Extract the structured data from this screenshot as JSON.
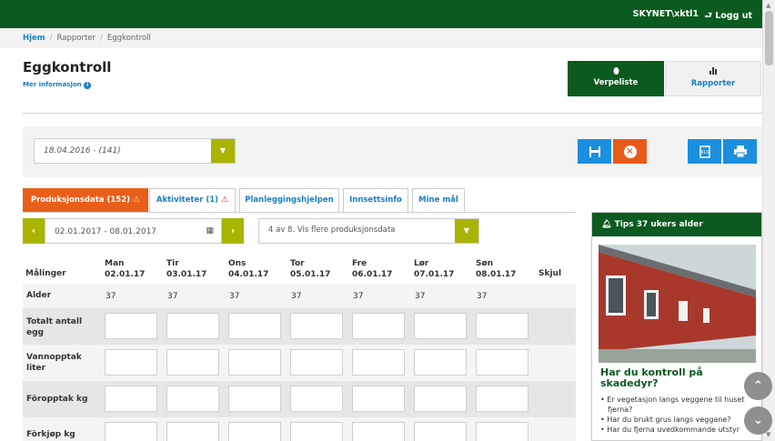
{
  "topbar": {
    "user": "SKYNET\\xktl1",
    "logout": "Logg ut",
    "logout_icon": "sign-out-icon"
  },
  "breadcrumb": {
    "home": "Hjem",
    "reports": "Rapporter",
    "current": "Eggkontroll"
  },
  "page": {
    "title": "Eggkontroll",
    "more_info": "Mer informasjon"
  },
  "buttons": {
    "verpeliste": {
      "label": "Verpeliste",
      "icon": "egg-icon"
    },
    "rapporter": {
      "label": "Rapporter",
      "icon": "bar-chart-icon"
    }
  },
  "date_select": {
    "value": "18.04.2016 - (141)"
  },
  "tabs": [
    {
      "label": "Produksjonsdata (152)",
      "warn": "⚠"
    },
    {
      "label": "Aktiviteter (1)",
      "warn": "⚠"
    },
    {
      "label": "Planleggingshjelpen",
      "warn": ""
    },
    {
      "label": "Innsettsinfo",
      "warn": ""
    },
    {
      "label": "Mine mål",
      "warn": ""
    }
  ],
  "week": {
    "range": "02.01.2017 - 08.01.2017"
  },
  "data_select": {
    "value": "4 av 8. Vis flere produksjonsdata"
  },
  "table": {
    "measure_header": "Målinger",
    "hide_header": "Skjul",
    "days": [
      {
        "day": "Man",
        "date": "02.01.17"
      },
      {
        "day": "Tir",
        "date": "03.01.17"
      },
      {
        "day": "Ons",
        "date": "04.01.17"
      },
      {
        "day": "Tor",
        "date": "05.01.17"
      },
      {
        "day": "Fre",
        "date": "06.01.17"
      },
      {
        "day": "Lør",
        "date": "07.01.17"
      },
      {
        "day": "Søn",
        "date": "08.01.17"
      }
    ],
    "age_label": "Alder",
    "ages": [
      "37",
      "37",
      "37",
      "37",
      "37",
      "37",
      "37"
    ],
    "rows": [
      {
        "label": "Totalt antall egg"
      },
      {
        "label": "Vannopptak liter"
      },
      {
        "label": "Föropptak kg"
      },
      {
        "label": "Förkjøp kg"
      }
    ]
  },
  "tips": {
    "header": "Tips 37 ukers alder",
    "title": "Har du kontroll på skadedyr?",
    "items": [
      "Er vegetasjon langs veggene til huset fjerna?",
      "Har du brukt grus langs veggane?",
      "Har du fjerna uvedkommande utstyr"
    ]
  }
}
